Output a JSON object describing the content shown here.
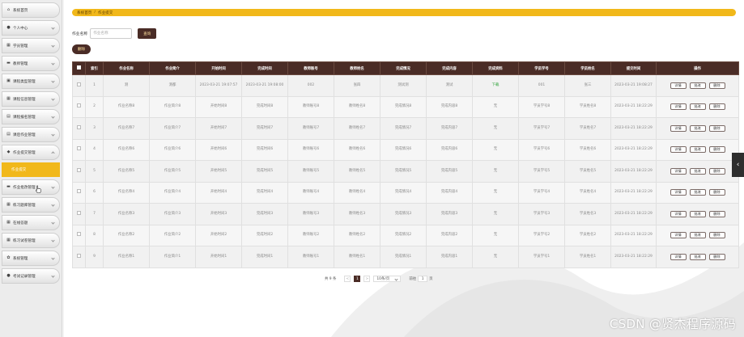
{
  "sidebar": {
    "items": [
      {
        "label": "系统首页",
        "icon": "home-icon",
        "glyph": "⌂"
      },
      {
        "label": "个人中心",
        "icon": "user-icon",
        "glyph": "●"
      },
      {
        "label": "学员管理",
        "icon": "grid-icon",
        "glyph": "▦"
      },
      {
        "label": "教师管理",
        "icon": "card-icon",
        "glyph": "▬"
      },
      {
        "label": "课程类型管理",
        "icon": "folder-icon",
        "glyph": "▣"
      },
      {
        "label": "课程信息管理",
        "icon": "grid-icon",
        "glyph": "▦"
      },
      {
        "label": "课程报名管理",
        "icon": "doc-icon",
        "glyph": "▤"
      },
      {
        "label": "课后作业管理",
        "icon": "doc-icon",
        "glyph": "▤"
      },
      {
        "label": "作业提交管理",
        "icon": "pin-icon",
        "glyph": "◆"
      },
      {
        "label": "作业批改管理",
        "icon": "card-icon",
        "glyph": "▬"
      },
      {
        "label": "练习题库管理",
        "icon": "grid-icon",
        "glyph": "▦"
      },
      {
        "label": "在线答题",
        "icon": "grid-icon",
        "glyph": "▦"
      },
      {
        "label": "练习试卷管理",
        "icon": "grid-icon",
        "glyph": "▦"
      },
      {
        "label": "系统管理",
        "icon": "gear-icon",
        "glyph": "✿"
      },
      {
        "label": "考试记录管理",
        "icon": "user-icon",
        "glyph": "●"
      }
    ],
    "active_sub": "作业提交"
  },
  "breadcrumb": {
    "home": "系统首页",
    "separator": "/",
    "current": "作业提交"
  },
  "search": {
    "label": "作业名称",
    "placeholder": "作业名称",
    "button": "查询"
  },
  "delete_button": "删除",
  "table": {
    "headers": [
      "",
      "索引",
      "作业名称",
      "作业简介",
      "开始时间",
      "完成时间",
      "教师账号",
      "教师姓名",
      "完成情况",
      "完成内容",
      "完成资料",
      "学员学号",
      "学员姓名",
      "提交时间",
      "操作"
    ],
    "rows": [
      [
        "1",
        "测",
        "测都",
        "2023-03-21 19:07:57",
        "2023-03-21 19:08:00",
        "002",
        "张四",
        "测试测",
        "测试",
        "下载",
        "001",
        "张三",
        "2023-03-21 19:08:27"
      ],
      [
        "2",
        "作业名称8",
        "作业简介8",
        "开始时间8",
        "完成时间8",
        "教师账号8",
        "教师姓名8",
        "完成情况8",
        "完成内容8",
        "无",
        "学员学号8",
        "学员姓名8",
        "2023-03-21 18:22:29"
      ],
      [
        "3",
        "作业名称7",
        "作业简介7",
        "开始时间7",
        "完成时间7",
        "教师账号7",
        "教师姓名7",
        "完成情况7",
        "完成内容7",
        "无",
        "学员学号7",
        "学员姓名7",
        "2023-03-21 18:22:29"
      ],
      [
        "4",
        "作业名称6",
        "作业简介6",
        "开始时间6",
        "完成时间6",
        "教师账号6",
        "教师姓名6",
        "完成情况6",
        "完成内容6",
        "无",
        "学员学号6",
        "学员姓名6",
        "2023-03-21 18:22:29"
      ],
      [
        "5",
        "作业名称5",
        "作业简介5",
        "开始时间5",
        "完成时间5",
        "教师账号5",
        "教师姓名5",
        "完成情况5",
        "完成内容5",
        "无",
        "学员学号5",
        "学员姓名5",
        "2023-03-21 18:22:29"
      ],
      [
        "6",
        "作业名称4",
        "作业简介4",
        "开始时间4",
        "完成时间4",
        "教师账号4",
        "教师姓名4",
        "完成情况4",
        "完成内容4",
        "无",
        "学员学号4",
        "学员姓名4",
        "2023-03-21 18:22:29"
      ],
      [
        "7",
        "作业名称3",
        "作业简介3",
        "开始时间3",
        "完成时间3",
        "教师账号3",
        "教师姓名3",
        "完成情况3",
        "完成内容3",
        "无",
        "学员学号3",
        "学员姓名3",
        "2023-03-21 18:22:29"
      ],
      [
        "8",
        "作业名称2",
        "作业简介2",
        "开始时间2",
        "完成时间2",
        "教师账号2",
        "教师姓名2",
        "完成情况2",
        "完成内容2",
        "无",
        "学员学号2",
        "学员姓名2",
        "2023-03-21 18:22:29"
      ],
      [
        "9",
        "作业名称1",
        "作业简介1",
        "开始时间1",
        "完成时间1",
        "教师账号1",
        "教师姓名1",
        "完成情况1",
        "完成内容1",
        "无",
        "学员学号1",
        "学员姓名1",
        "2023-03-21 18:22:29"
      ]
    ],
    "actions": [
      "详情",
      "批改",
      "删除"
    ]
  },
  "pagination": {
    "total": "共 9 条",
    "prev": "<",
    "current_page": "1",
    "next": ">",
    "page_size": "10条/页",
    "jump_label": "前往",
    "jump_value": "1",
    "page_unit": "页"
  },
  "side_handle": "‹",
  "watermark": "CSDN @贤杰程序源码",
  "colors": {
    "accent": "#f1b81a",
    "dark": "#4a2c26",
    "download": "#2fa33a"
  }
}
